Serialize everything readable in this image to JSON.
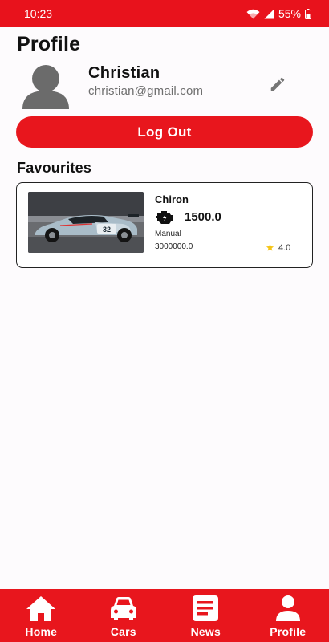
{
  "status_bar": {
    "time": "10:23",
    "battery": "55%",
    "icons": [
      "wifi-icon",
      "signal-icon",
      "battery-icon"
    ]
  },
  "header": {
    "title": "Profile"
  },
  "profile": {
    "name": "Christian",
    "email": "christian@gmail.com",
    "avatar_icon": "person-avatar-icon",
    "edit_icon": "pencil-icon"
  },
  "actions": {
    "logout_label": "Log Out"
  },
  "favourites": {
    "title": "Favourites",
    "items": [
      {
        "name": "Chiron",
        "power": "1500.0",
        "transmission": "Manual",
        "price": "3000000.0",
        "rating": "4.0",
        "engine_icon": "engine-icon",
        "rating_icon": "star-icon"
      }
    ]
  },
  "bottom_nav": {
    "items": [
      {
        "label": "Home",
        "icon": "home-icon"
      },
      {
        "label": "Cars",
        "icon": "car-icon"
      },
      {
        "label": "News",
        "icon": "news-icon"
      },
      {
        "label": "Profile",
        "icon": "profile-icon"
      }
    ]
  },
  "colors": {
    "accent": "#e8161d",
    "background": "#fdfbfd",
    "text": "#111111",
    "muted_text": "#6f6f6f",
    "star": "#f5c518"
  }
}
